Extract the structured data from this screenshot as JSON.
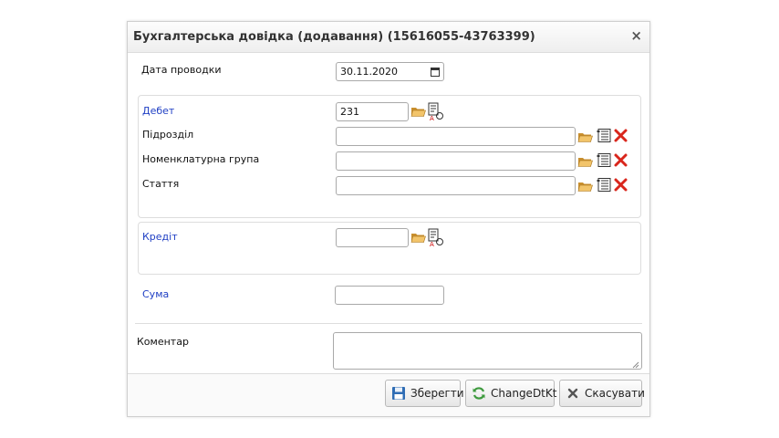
{
  "dialog": {
    "title": "Бухгалтерська довідка (додавання) (15616055-43763399)",
    "close_label": "×"
  },
  "form": {
    "date": {
      "label": "Дата проводки",
      "value": "30.11.2020"
    },
    "debet": {
      "label": "Дебет",
      "value": "231",
      "subdivision_label": "Підрозділ",
      "subdivision_value": "",
      "nomenclature_label": "Номенклатурна група",
      "nomenclature_value": "",
      "article_label": "Стаття",
      "article_value": ""
    },
    "credit": {
      "label": "Кредіт",
      "value": ""
    },
    "sum": {
      "label": "Сума",
      "value": ""
    },
    "comment": {
      "label": "Коментар",
      "value": ""
    }
  },
  "buttons": {
    "save_label": "Зберегти",
    "change_label": "ChangeDtKt",
    "cancel_label": "Скасувати"
  },
  "colors": {
    "section_label": "#1f3fc4",
    "delete_icon": "#d9261c",
    "folder_icon": "#d9a441"
  },
  "icons": {
    "folder": "folder-open-icon",
    "account_card": "account-card-icon",
    "list": "list-icon",
    "delete": "delete-icon",
    "save": "floppy-disk-icon",
    "change": "refresh-icon",
    "cancel": "x-icon"
  }
}
